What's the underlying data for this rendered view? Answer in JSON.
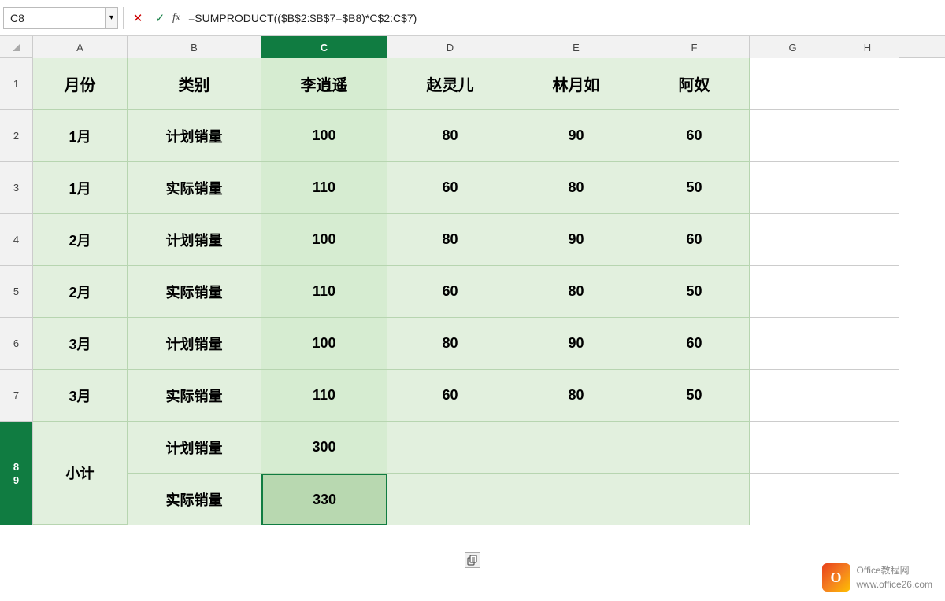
{
  "formulaBar": {
    "cellName": "C8",
    "formula": "=SUMPRODUCT(($B$2:$B$7=$B8)*C$2:C$7)",
    "cancelLabel": "✕",
    "confirmLabel": "✓",
    "fxLabel": "fx"
  },
  "columns": {
    "corner": "",
    "headers": [
      {
        "id": "A",
        "label": "A",
        "width": "col-a"
      },
      {
        "id": "B",
        "label": "B",
        "width": "col-b"
      },
      {
        "id": "C",
        "label": "C",
        "width": "col-c",
        "active": true
      },
      {
        "id": "D",
        "label": "D",
        "width": "col-d"
      },
      {
        "id": "E",
        "label": "E",
        "width": "col-e"
      },
      {
        "id": "F",
        "label": "F",
        "width": "col-f"
      },
      {
        "id": "G",
        "label": "G",
        "width": "col-g"
      },
      {
        "id": "H",
        "label": "H",
        "width": "col-h"
      }
    ]
  },
  "rows": [
    {
      "rowNum": "1",
      "cells": [
        {
          "col": "a",
          "value": "月份",
          "type": "header"
        },
        {
          "col": "b",
          "value": "类别",
          "type": "header"
        },
        {
          "col": "c",
          "value": "李逍遥",
          "type": "header"
        },
        {
          "col": "d",
          "value": "赵灵儿",
          "type": "header"
        },
        {
          "col": "e",
          "value": "林月如",
          "type": "header"
        },
        {
          "col": "f",
          "value": "阿奴",
          "type": "header"
        },
        {
          "col": "g",
          "value": "",
          "type": "empty"
        },
        {
          "col": "h",
          "value": "",
          "type": "empty"
        }
      ]
    },
    {
      "rowNum": "2",
      "cells": [
        {
          "col": "a",
          "value": "1月",
          "type": "data"
        },
        {
          "col": "b",
          "value": "计划销量",
          "type": "data"
        },
        {
          "col": "c",
          "value": "100",
          "type": "data"
        },
        {
          "col": "d",
          "value": "80",
          "type": "data"
        },
        {
          "col": "e",
          "value": "90",
          "type": "data"
        },
        {
          "col": "f",
          "value": "60",
          "type": "data"
        },
        {
          "col": "g",
          "value": "",
          "type": "empty"
        },
        {
          "col": "h",
          "value": "",
          "type": "empty"
        }
      ]
    },
    {
      "rowNum": "3",
      "cells": [
        {
          "col": "a",
          "value": "1月",
          "type": "data"
        },
        {
          "col": "b",
          "value": "实际销量",
          "type": "data"
        },
        {
          "col": "c",
          "value": "110",
          "type": "data"
        },
        {
          "col": "d",
          "value": "60",
          "type": "data"
        },
        {
          "col": "e",
          "value": "80",
          "type": "data"
        },
        {
          "col": "f",
          "value": "50",
          "type": "data"
        },
        {
          "col": "g",
          "value": "",
          "type": "empty"
        },
        {
          "col": "h",
          "value": "",
          "type": "empty"
        }
      ]
    },
    {
      "rowNum": "4",
      "cells": [
        {
          "col": "a",
          "value": "2月",
          "type": "data"
        },
        {
          "col": "b",
          "value": "计划销量",
          "type": "data"
        },
        {
          "col": "c",
          "value": "100",
          "type": "data"
        },
        {
          "col": "d",
          "value": "80",
          "type": "data"
        },
        {
          "col": "e",
          "value": "90",
          "type": "data"
        },
        {
          "col": "f",
          "value": "60",
          "type": "data"
        },
        {
          "col": "g",
          "value": "",
          "type": "empty"
        },
        {
          "col": "h",
          "value": "",
          "type": "empty"
        }
      ]
    },
    {
      "rowNum": "5",
      "cells": [
        {
          "col": "a",
          "value": "2月",
          "type": "data"
        },
        {
          "col": "b",
          "value": "实际销量",
          "type": "data"
        },
        {
          "col": "c",
          "value": "110",
          "type": "data"
        },
        {
          "col": "d",
          "value": "60",
          "type": "data"
        },
        {
          "col": "e",
          "value": "80",
          "type": "data"
        },
        {
          "col": "f",
          "value": "50",
          "type": "data"
        },
        {
          "col": "g",
          "value": "",
          "type": "empty"
        },
        {
          "col": "h",
          "value": "",
          "type": "empty"
        }
      ]
    },
    {
      "rowNum": "6",
      "cells": [
        {
          "col": "a",
          "value": "3月",
          "type": "data"
        },
        {
          "col": "b",
          "value": "计划销量",
          "type": "data"
        },
        {
          "col": "c",
          "value": "100",
          "type": "data"
        },
        {
          "col": "d",
          "value": "80",
          "type": "data"
        },
        {
          "col": "e",
          "value": "90",
          "type": "data"
        },
        {
          "col": "f",
          "value": "60",
          "type": "data"
        },
        {
          "col": "g",
          "value": "",
          "type": "empty"
        },
        {
          "col": "h",
          "value": "",
          "type": "empty"
        }
      ]
    },
    {
      "rowNum": "7",
      "cells": [
        {
          "col": "a",
          "value": "3月",
          "type": "data"
        },
        {
          "col": "b",
          "value": "实际销量",
          "type": "data"
        },
        {
          "col": "c",
          "value": "110",
          "type": "data"
        },
        {
          "col": "d",
          "value": "60",
          "type": "data"
        },
        {
          "col": "e",
          "value": "80",
          "type": "data"
        },
        {
          "col": "f",
          "value": "50",
          "type": "data"
        },
        {
          "col": "g",
          "value": "",
          "type": "empty"
        },
        {
          "col": "h",
          "value": "",
          "type": "empty"
        }
      ]
    },
    {
      "rowNum": "8",
      "cells": [
        {
          "col": "a",
          "value": "小计",
          "type": "subtotal-merged"
        },
        {
          "col": "b",
          "value": "计划销量",
          "type": "data"
        },
        {
          "col": "c",
          "value": "300",
          "type": "data"
        },
        {
          "col": "d",
          "value": "",
          "type": "data-empty"
        },
        {
          "col": "e",
          "value": "",
          "type": "data-empty"
        },
        {
          "col": "f",
          "value": "",
          "type": "data-empty"
        },
        {
          "col": "g",
          "value": "",
          "type": "empty"
        },
        {
          "col": "h",
          "value": "",
          "type": "empty"
        }
      ]
    },
    {
      "rowNum": "9",
      "cells": [
        {
          "col": "a",
          "value": "",
          "type": "subtotal-merged-continue"
        },
        {
          "col": "b",
          "value": "实际销量",
          "type": "data"
        },
        {
          "col": "c",
          "value": "330",
          "type": "active"
        },
        {
          "col": "d",
          "value": "",
          "type": "data-empty"
        },
        {
          "col": "e",
          "value": "",
          "type": "data-empty"
        },
        {
          "col": "f",
          "value": "",
          "type": "data-empty"
        },
        {
          "col": "g",
          "value": "",
          "type": "empty"
        },
        {
          "col": "h",
          "value": "",
          "type": "empty"
        }
      ]
    }
  ],
  "watermark": {
    "line1": "Office教程网",
    "line2": "www.office26.com"
  }
}
